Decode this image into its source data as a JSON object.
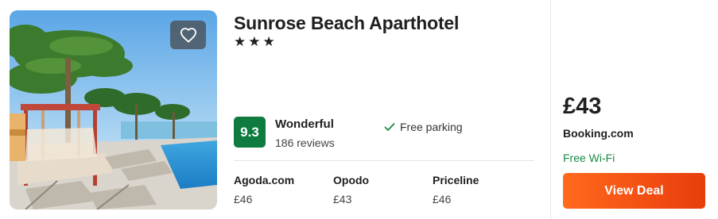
{
  "hotel": {
    "name": "Sunrose Beach Aparthotel",
    "stars_text": "★★★",
    "star_count": 3,
    "image_alt_icon": "hotel-photo",
    "favorite_icon": "heart-outline-icon"
  },
  "rating": {
    "score": "9.3",
    "label": "Wonderful",
    "reviews": "186 reviews",
    "badge_color": "#0f7b3f"
  },
  "amenity": {
    "icon": "check-icon",
    "label": "Free parking",
    "icon_color": "#1a8a45"
  },
  "providers": [
    {
      "name": "Agoda.com",
      "price": "£46"
    },
    {
      "name": "Opodo",
      "price": "£43"
    },
    {
      "name": "Priceline",
      "price": "£46"
    }
  ],
  "best_deal": {
    "price": "£43",
    "provider": "Booking.com",
    "perk": "Free Wi-Fi",
    "button_label": "View Deal",
    "accent_color": "#f24e12"
  }
}
